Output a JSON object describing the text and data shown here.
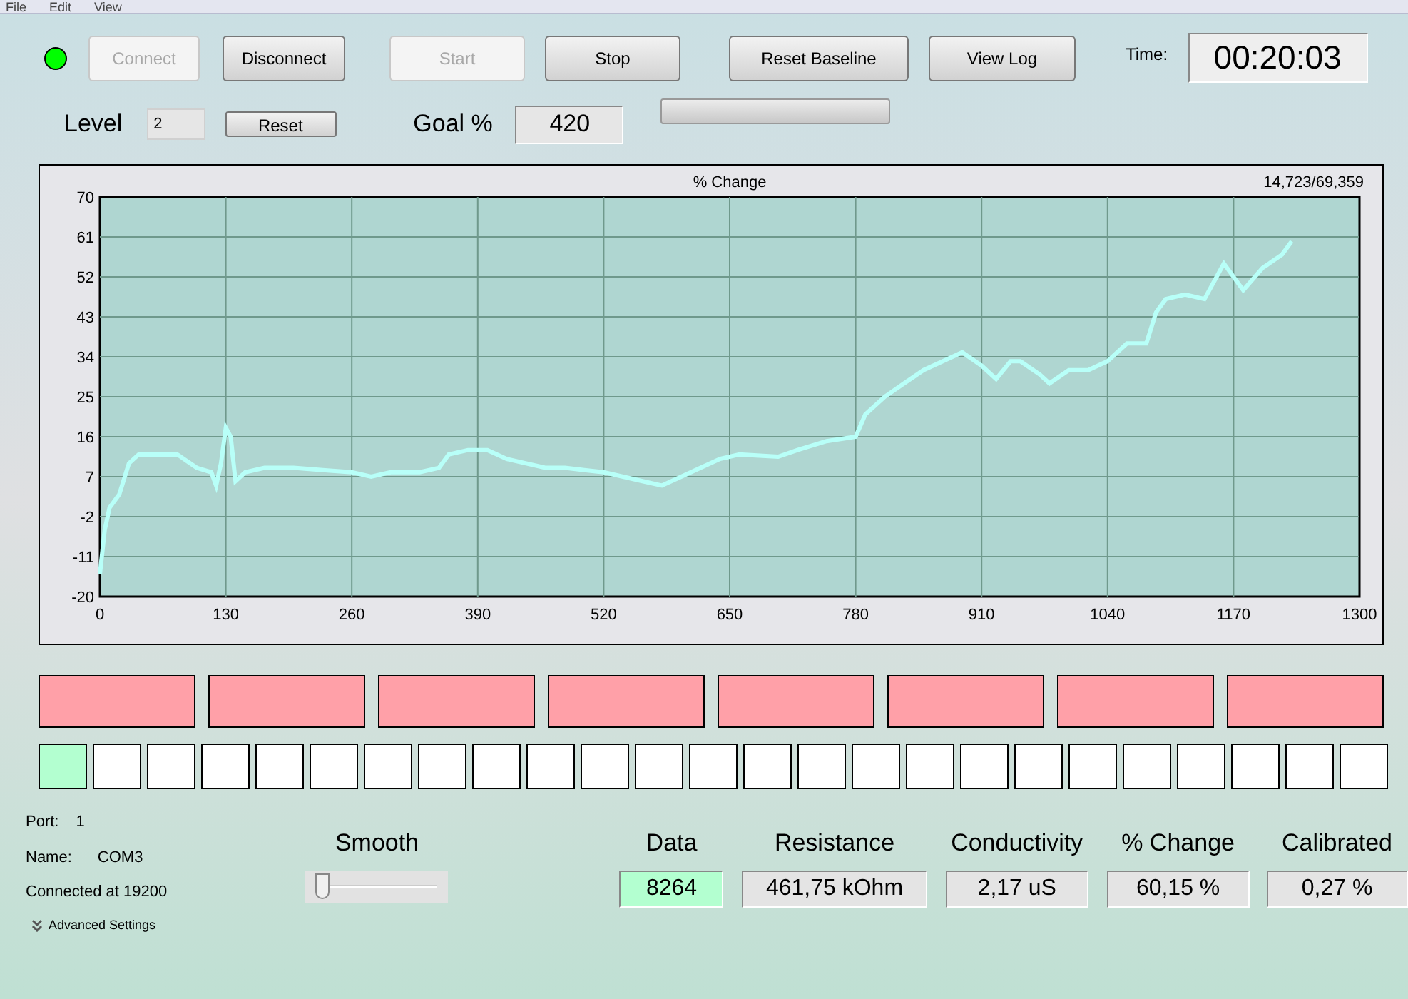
{
  "menu": [
    "File",
    "Edit",
    "View"
  ],
  "toolbar": {
    "status_led": {
      "on": true
    },
    "buttons": [
      {
        "label": "Connect",
        "disabled": true
      },
      {
        "label": "Disconnect",
        "disabled": false
      },
      {
        "label": "Start",
        "disabled": true
      },
      {
        "label": "Stop",
        "disabled": false
      },
      {
        "label": "Reset Baseline",
        "disabled": false
      },
      {
        "label": "View Log",
        "disabled": false
      }
    ],
    "time_label": "Time:",
    "time": "00:20:03"
  },
  "level": {
    "label": "Level",
    "value": "2",
    "reset_button": "Reset"
  },
  "goal": {
    "label": "Goal %",
    "value": "420",
    "progress": {
      "level": 0
    }
  },
  "chart_panel": {
    "counter": "14,723/69,359",
    "chart_data": {
      "type": "line",
      "title": "% Change",
      "grid": true,
      "xlim": [
        0,
        1300
      ],
      "ylim": [
        -20,
        70
      ],
      "xticks": [
        0,
        130,
        260,
        390,
        520,
        650,
        780,
        910,
        1040,
        1170,
        1300
      ],
      "yticks": [
        -20,
        -11,
        -2,
        7,
        16,
        25,
        34,
        43,
        52,
        61,
        70
      ],
      "x": [
        0,
        5,
        10,
        20,
        30,
        40,
        60,
        80,
        100,
        115,
        120,
        125,
        130,
        135,
        140,
        150,
        170,
        200,
        230,
        260,
        280,
        300,
        330,
        350,
        360,
        380,
        400,
        420,
        440,
        460,
        480,
        500,
        520,
        540,
        560,
        580,
        600,
        620,
        640,
        660,
        700,
        720,
        750,
        780,
        790,
        810,
        830,
        850,
        870,
        890,
        910,
        925,
        940,
        950,
        970,
        980,
        1000,
        1020,
        1040,
        1060,
        1080,
        1090,
        1100,
        1120,
        1140,
        1160,
        1180,
        1200,
        1220,
        1230
      ],
      "series": [
        {
          "color": "#b8fff8",
          "values": [
            -15,
            -5,
            0,
            3,
            10,
            12,
            12,
            12,
            9,
            8,
            5,
            10,
            18,
            16,
            6,
            8,
            9,
            9,
            8.5,
            8,
            7,
            8,
            8,
            9,
            12,
            13,
            13,
            11,
            10,
            9,
            9,
            8.5,
            8,
            7,
            6,
            5,
            7,
            9,
            11,
            12,
            11.5,
            13,
            15,
            16,
            21,
            25,
            28,
            31,
            33,
            35,
            32,
            29,
            33,
            33,
            30,
            28,
            31,
            31,
            33,
            37,
            37,
            44,
            47,
            48,
            47,
            55,
            49,
            54,
            57,
            60
          ]
        }
      ]
    }
  },
  "zones": [
    {
      "active": true
    },
    {
      "active": true
    },
    {
      "active": true
    },
    {
      "active": true
    },
    {
      "active": true
    },
    {
      "active": true
    },
    {
      "active": true
    },
    {
      "active": true
    }
  ],
  "indicators": [
    {
      "on": true
    },
    {
      "on": false
    },
    {
      "on": false
    },
    {
      "on": false
    },
    {
      "on": false
    },
    {
      "on": false
    },
    {
      "on": false
    },
    {
      "on": false
    },
    {
      "on": false
    },
    {
      "on": false
    },
    {
      "on": false
    },
    {
      "on": false
    },
    {
      "on": false
    },
    {
      "on": false
    },
    {
      "on": false
    },
    {
      "on": false
    },
    {
      "on": false
    },
    {
      "on": false
    },
    {
      "on": false
    },
    {
      "on": false
    },
    {
      "on": false
    },
    {
      "on": false
    },
    {
      "on": false
    },
    {
      "on": false
    },
    {
      "on": false
    }
  ],
  "connection": {
    "port_label": "Port:",
    "port": "1",
    "name_label": "Name:",
    "name": "COM3",
    "status": "Connected at 19200",
    "advanced": "Advanced Settings"
  },
  "smooth": {
    "label": "Smooth",
    "level": 0.05
  },
  "readouts": [
    {
      "label": "Data",
      "value": "8264",
      "highlighted": true
    },
    {
      "label": "Resistance",
      "value": "461,75 kOhm",
      "highlighted": false
    },
    {
      "label": "Conductivity",
      "value": "2,17 uS",
      "highlighted": false
    },
    {
      "label": "% Change",
      "value": "60,15 %",
      "highlighted": false
    },
    {
      "label": "Calibrated",
      "value": "0,27 %",
      "highlighted": false
    }
  ]
}
